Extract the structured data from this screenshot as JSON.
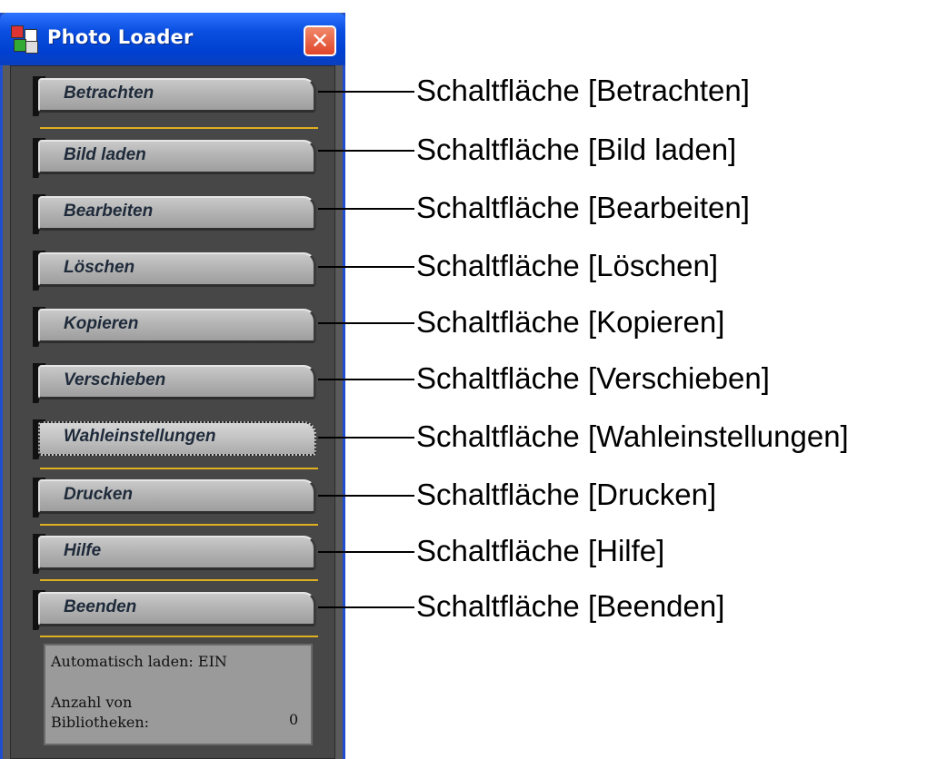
{
  "window": {
    "title": "Photo Loader",
    "close_glyph": "✕"
  },
  "buttons": [
    {
      "label": "Betrachten"
    },
    {
      "label": "Bild laden"
    },
    {
      "label": "Bearbeiten"
    },
    {
      "label": "Löschen"
    },
    {
      "label": "Kopieren"
    },
    {
      "label": "Verschieben"
    },
    {
      "label": "Wahleinstellungen"
    },
    {
      "label": "Drucken"
    },
    {
      "label": "Hilfe"
    },
    {
      "label": "Beenden"
    }
  ],
  "status": {
    "auto_load": "Automatisch laden: EIN",
    "libraries_label": "Anzahl von Bibliotheken:",
    "libraries_count": "0"
  },
  "callouts": [
    "Schaltfläche [Betrachten]",
    "Schaltfläche [Bild laden]",
    "Schaltfläche [Bearbeiten]",
    "Schaltfläche [Löschen]",
    "Schaltfläche [Kopieren]",
    "Schaltfläche [Verschieben]",
    "Schaltfläche [Wahleinstellungen]",
    "Schaltfläche [Drucken]",
    "Schaltfläche [Hilfe]",
    "Schaltfläche [Beenden]"
  ],
  "colors": {
    "titlebar": "#0a4fe0",
    "separator": "#e0b020",
    "panel": "#474747"
  }
}
